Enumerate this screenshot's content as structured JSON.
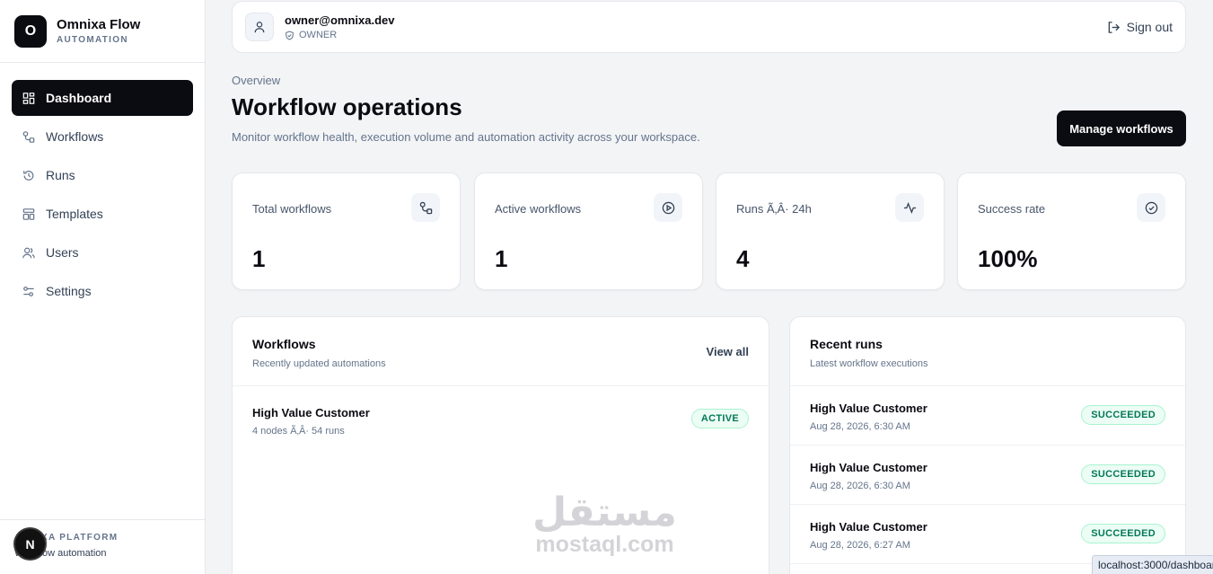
{
  "brand": {
    "logo_letter": "O",
    "name": "Omnixa Flow",
    "subtitle": "AUTOMATION"
  },
  "sidebar": {
    "items": [
      {
        "label": "Dashboard",
        "icon": "dashboard-icon",
        "active": true
      },
      {
        "label": "Workflows",
        "icon": "workflow-icon",
        "active": false
      },
      {
        "label": "Runs",
        "icon": "history-icon",
        "active": false
      },
      {
        "label": "Templates",
        "icon": "template-icon",
        "active": false
      },
      {
        "label": "Users",
        "icon": "users-icon",
        "active": false
      },
      {
        "label": "Settings",
        "icon": "settings-icon",
        "active": false
      }
    ],
    "footer_title": "XA PLATFORM",
    "footer_sub": "Workflow automation",
    "next_badge": "N"
  },
  "topbar": {
    "email": "owner@omnixa.dev",
    "role": "OWNER",
    "signout_label": "Sign out"
  },
  "header": {
    "overview": "Overview",
    "title": "Workflow operations",
    "description": "Monitor workflow health, execution volume and automation activity across your workspace.",
    "manage_label": "Manage workflows"
  },
  "stats": [
    {
      "label": "Total workflows",
      "value": "1",
      "icon": "workflow-icon"
    },
    {
      "label": "Active workflows",
      "value": "1",
      "icon": "play-circle-icon"
    },
    {
      "label": "Runs Ã‚Â· 24h",
      "value": "4",
      "icon": "activity-icon"
    },
    {
      "label": "Success rate",
      "value": "100%",
      "icon": "check-circle-icon"
    }
  ],
  "workflows_panel": {
    "title": "Workflows",
    "subtitle": "Recently updated automations",
    "view_all": "View all",
    "items": [
      {
        "name": "High Value Customer",
        "meta": "4 nodes Ã‚Â· 54 runs",
        "status": "ACTIVE"
      }
    ]
  },
  "runs_panel": {
    "title": "Recent runs",
    "subtitle": "Latest workflow executions",
    "items": [
      {
        "name": "High Value Customer",
        "time": "Aug 28, 2026, 6:30 AM",
        "status": "SUCCEEDED"
      },
      {
        "name": "High Value Customer",
        "time": "Aug 28, 2026, 6:30 AM",
        "status": "SUCCEEDED"
      },
      {
        "name": "High Value Customer",
        "time": "Aug 28, 2026, 6:27 AM",
        "status": "SUCCEEDED"
      }
    ]
  },
  "watermark": {
    "arabic": "مستقل",
    "latin": "mostaql.com"
  },
  "status_url": "localhost:3000/dashboard",
  "colors": {
    "primary": "#0b0b12",
    "success_text": "#047857",
    "success_bg": "#ecfdf5"
  }
}
